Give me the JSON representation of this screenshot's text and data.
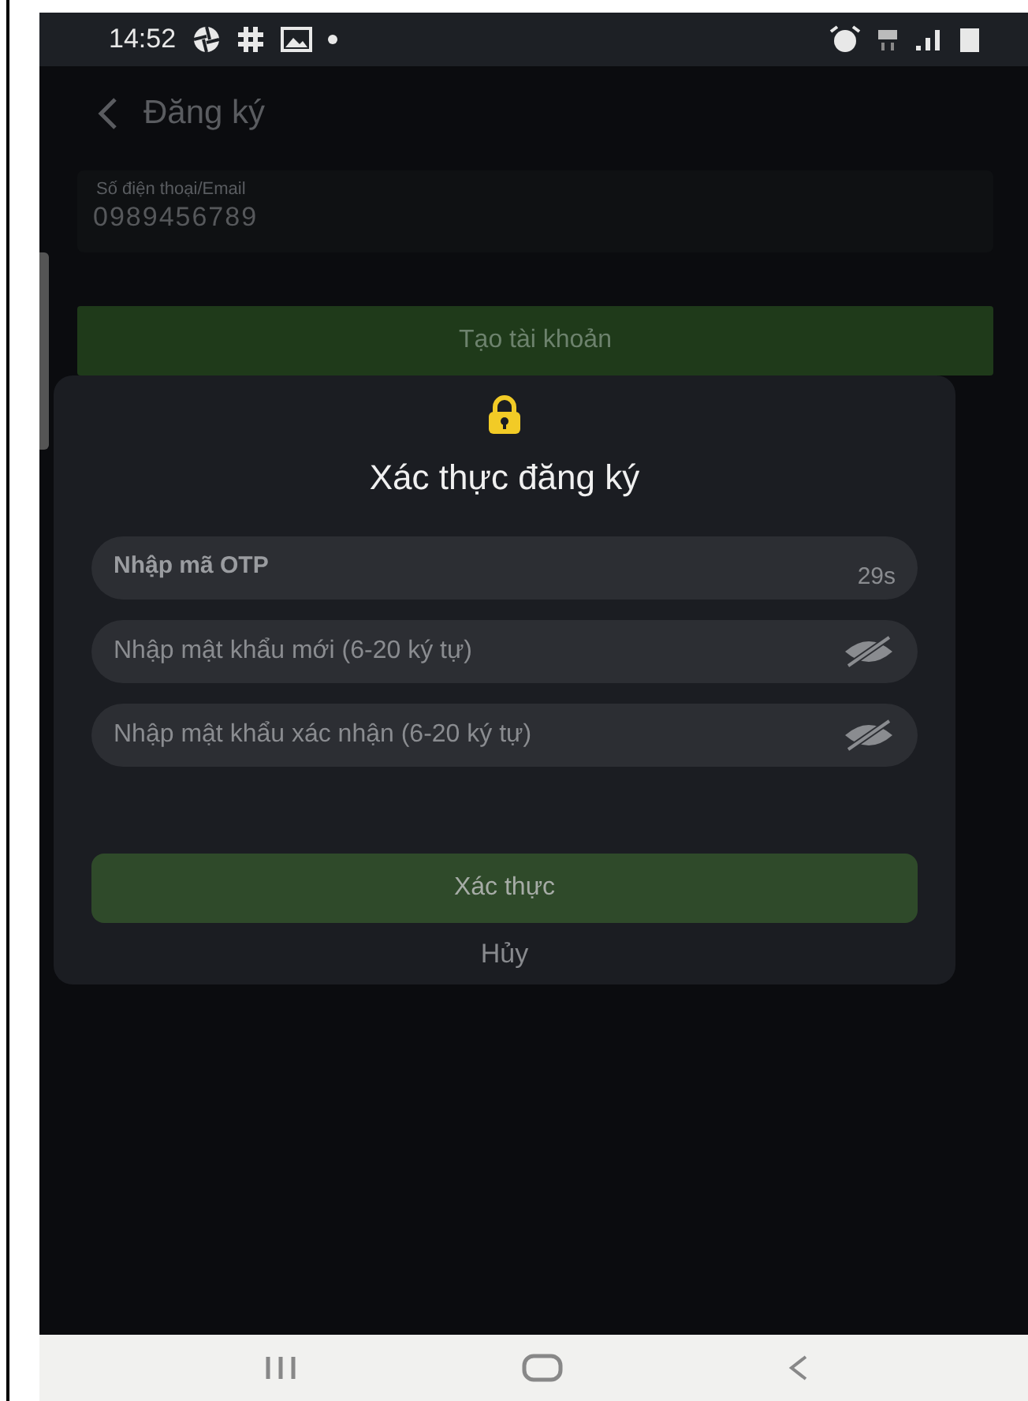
{
  "status_bar": {
    "time": "14:52"
  },
  "header": {
    "title": "Đăng ký"
  },
  "account_field": {
    "label": "Số điện thoại/Email",
    "value": "0989456789"
  },
  "create_button": {
    "label": "Tạo tài khoản"
  },
  "dialog": {
    "title": "Xác thực đăng ký",
    "fields": [
      {
        "kind": "otp",
        "placeholder": "Nhập mã OTP",
        "countdown": "29s"
      },
      {
        "kind": "password",
        "placeholder": "Nhập mật khẩu mới (6-20 ký tự)"
      },
      {
        "kind": "password",
        "placeholder": "Nhập mật khẩu xác nhận (6-20 ký tự)"
      }
    ],
    "confirm_button": "Xác thực",
    "cancel_button": "Hủy"
  }
}
